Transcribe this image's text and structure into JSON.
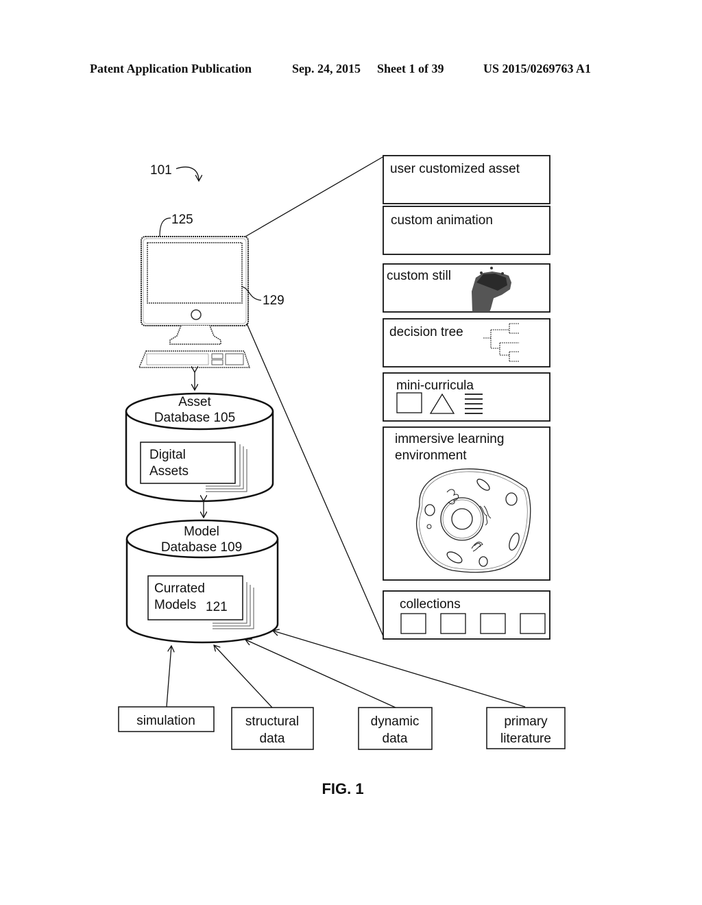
{
  "header": {
    "publication": "Patent Application Publication",
    "date": "Sep. 24, 2015",
    "sheet": "Sheet 1 of 39",
    "number": "US 2015/0269763 A1"
  },
  "figure": {
    "caption": "FIG. 1",
    "system_ref": "101",
    "computer_ref": "125",
    "display_ref": "129",
    "asset_db": {
      "line1": "Asset",
      "line2": "Database 105",
      "inner_line1": "Digital",
      "inner_line2": "Assets"
    },
    "model_db": {
      "line1": "Model",
      "line2": "Database 109",
      "inner_line1": "Currated",
      "inner_line2": "Models",
      "inner_ref": "121"
    },
    "asset_panels": [
      {
        "label": "user customized asset"
      },
      {
        "label": "custom animation"
      },
      {
        "label": "custom still"
      },
      {
        "label": "decision tree"
      },
      {
        "label": "mini-curricula"
      },
      {
        "label_line1": "immersive learning",
        "label_line2": "environment"
      },
      {
        "label": "collections"
      }
    ],
    "sources": [
      {
        "line1": "simulation",
        "line2": ""
      },
      {
        "line1": "structural",
        "line2": "data"
      },
      {
        "line1": "dynamic",
        "line2": "data"
      },
      {
        "line1": "primary",
        "line2": "literature"
      }
    ]
  }
}
